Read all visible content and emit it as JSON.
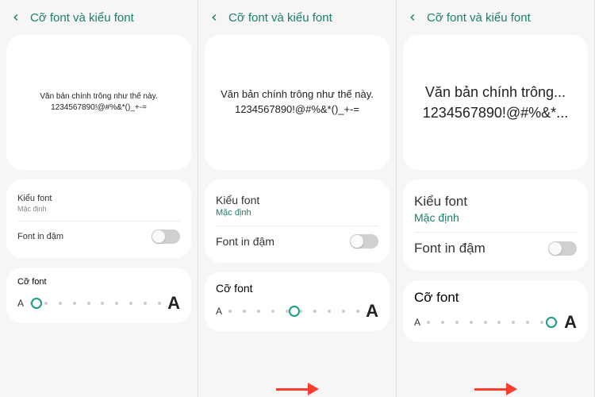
{
  "header": {
    "title": "Cỡ font và kiểu font"
  },
  "preview": {
    "line1_s0": "Văn bản chính trông như thế này.",
    "line2_s0": "1234567890!@#%&*()_+-=",
    "line1_s1": "Văn bản chính trông như thế này.",
    "line2_s1": "1234567890!@#%&*()_+-=",
    "line1_s2": "Văn bản chính trông...",
    "line2_s2": "1234567890!@#%&*..."
  },
  "fontStyle": {
    "label": "Kiểu font",
    "value": "Mặc định"
  },
  "bold": {
    "label": "Font in đậm",
    "enabled": false
  },
  "size": {
    "label": "Cỡ font",
    "small": "A",
    "large": "A",
    "steps": 10,
    "positions": {
      "s0": 0,
      "s1": 5,
      "s2": 9
    }
  }
}
